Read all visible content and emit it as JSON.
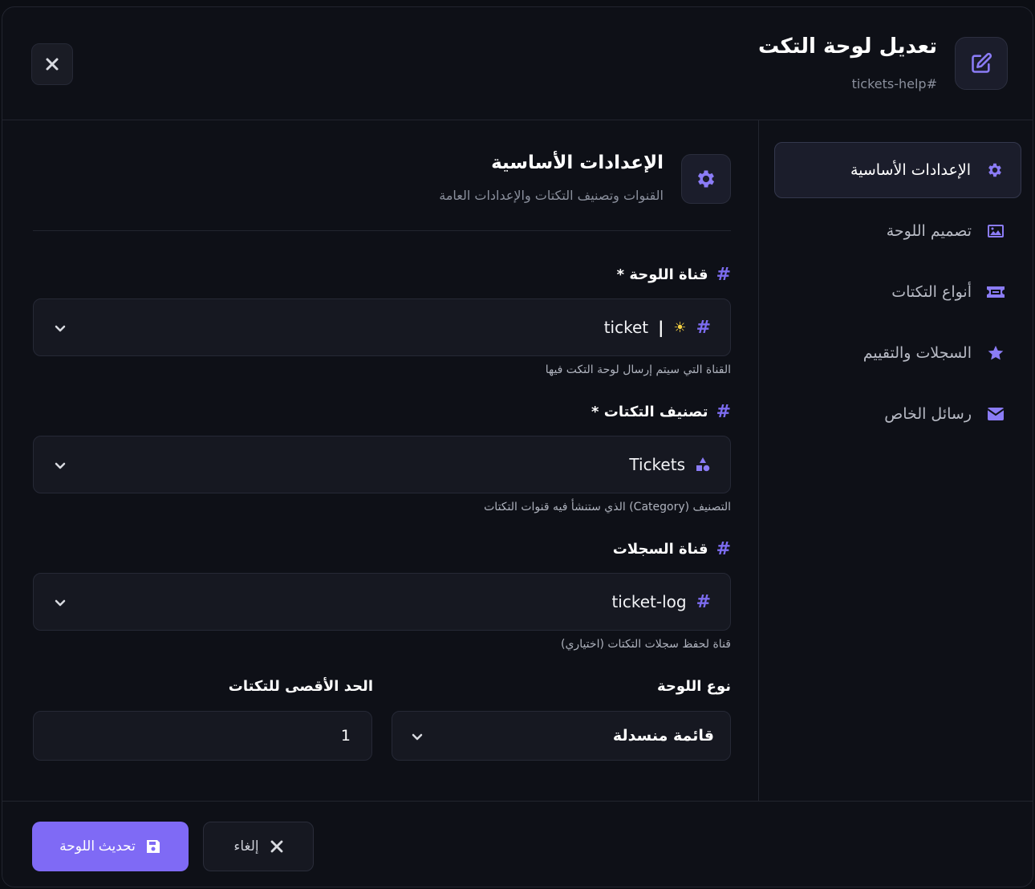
{
  "header": {
    "title": "تعديل لوحة التكت",
    "subtitle": "tickets-help#"
  },
  "sidebar": {
    "items": [
      {
        "label": "الإعدادات الأساسية",
        "icon": "gear-icon",
        "active": true
      },
      {
        "label": "تصميم اللوحة",
        "icon": "image-icon",
        "active": false
      },
      {
        "label": "أنواع التكتات",
        "icon": "ticket-icon",
        "active": false
      },
      {
        "label": "السجلات والتقييم",
        "icon": "star-icon",
        "active": false
      },
      {
        "label": "رسائل الخاص",
        "icon": "envelope-icon",
        "active": false
      }
    ]
  },
  "section": {
    "title": "الإعدادات الأساسية",
    "subtitle": "القنوات وتصنيف التكتات والإعدادات العامة"
  },
  "fields": {
    "panel_channel": {
      "label": "قناة اللوحة *",
      "value": "ticket",
      "help": "القناة التي سيتم إرسال لوحة التكت فيها"
    },
    "category": {
      "label": "تصنيف التكتات *",
      "value": "Tickets",
      "help": "التصنيف (Category) الذي ستنشأ فيه قنوات التكتات"
    },
    "log_channel": {
      "label": "قناة السجلات",
      "value": "ticket-log",
      "help": "قناة لحفظ سجلات التكتات (اختياري)"
    },
    "panel_type": {
      "label": "نوع اللوحة",
      "value": "قائمة منسدلة"
    },
    "max_tickets": {
      "label": "الحد الأقصى للتكتات",
      "value": "1"
    }
  },
  "footer": {
    "update_label": "تحديث اللوحة",
    "cancel_label": "إلغاء"
  },
  "colors": {
    "accent": "#7f6af5",
    "background": "#0e1017"
  }
}
